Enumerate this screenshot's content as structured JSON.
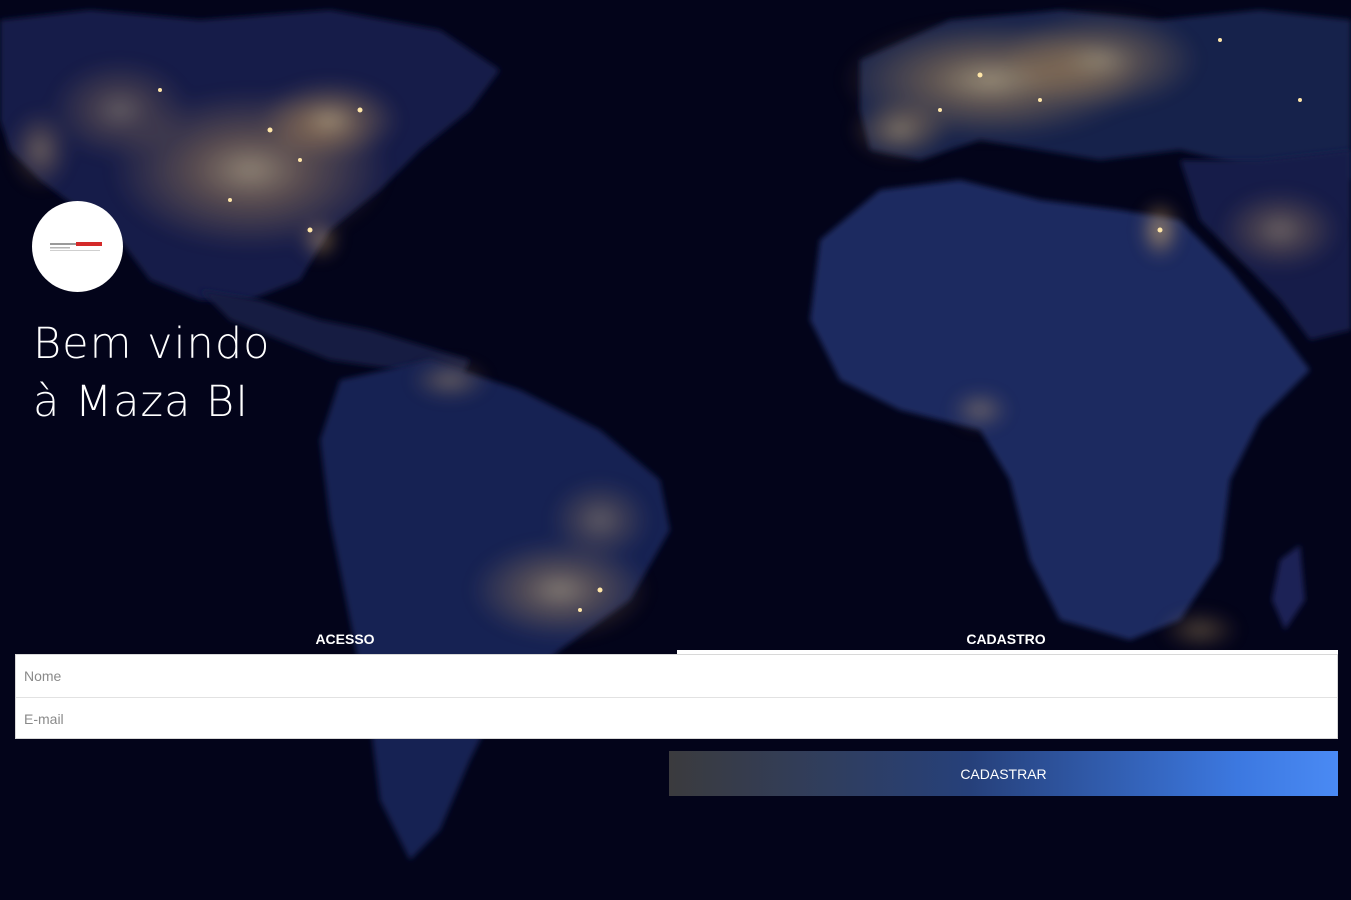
{
  "colors": {
    "background": "#03041a",
    "city_lights": "#ffd98a",
    "land": "#1a2352",
    "button_gradient_start": "#3b3b3e",
    "button_gradient_end": "#4a8af4",
    "logo_accent": "#d42a2a"
  },
  "logo": {
    "icon": "company-logo-icon"
  },
  "welcome": {
    "line1": "Bem vindo",
    "line2": "à Maza BI"
  },
  "tabs": {
    "acesso": "ACESSO",
    "cadastro": "CADASTRO",
    "active": "cadastro"
  },
  "form": {
    "name_placeholder": "Nome",
    "name_value": "",
    "email_placeholder": "E-mail",
    "email_value": ""
  },
  "buttons": {
    "submit_label": "CADASTRAR"
  }
}
